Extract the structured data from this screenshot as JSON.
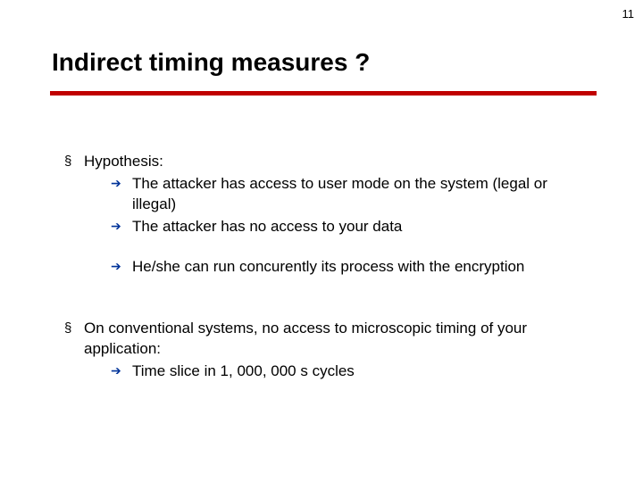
{
  "page_number": "11",
  "title": "Indirect timing measures ?",
  "bullets": [
    {
      "text": "Hypothesis:",
      "sub": [
        "The attacker has access to user mode on the system (legal or illegal)",
        "The attacker has no access to your data"
      ],
      "sub_after_gap": [
        "He/she can run concurently its process with the encryption"
      ]
    },
    {
      "text": "On conventional systems, no access to microscopic timing of your application:",
      "sub": [
        "Time slice  in 1, 000, 000 s cycles"
      ]
    }
  ]
}
